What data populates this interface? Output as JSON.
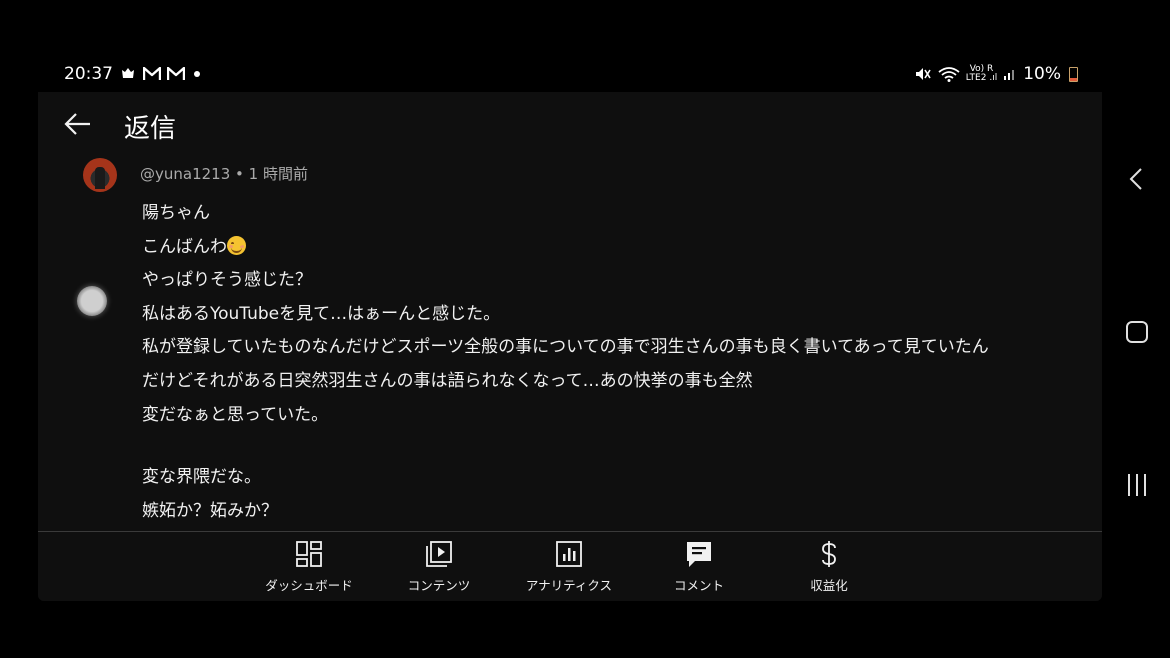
{
  "status_bar": {
    "time": "20:37",
    "notification_icons": [
      "bug-icon",
      "gmail-icon",
      "gmail-icon",
      "dot-icon"
    ],
    "network_label_top": "Vo) R",
    "network_label_bottom": "LTE2 .ıl",
    "battery": "10%"
  },
  "header": {
    "title": "返信"
  },
  "comment": {
    "meta": "@yuna1213 • 1 時間前",
    "lines": [
      "陽ちゃん",
      "こんばんわ",
      "やっぱりそう感じた？",
      "私はあるYouTubeを見て…はぁーんと感じた。",
      "私が登録していたものなんだけどスポーツ全般の事についての事で羽生さんの事も良く書いてあって見ていたん",
      "だけどそれがある日突然羽生さんの事は語られなくなって…あの快挙の事も全然",
      "変だなぁと思っていた。",
      "",
      "変な界隈だな。",
      "嫉妬か？妬みか？"
    ]
  },
  "bottom_nav": {
    "items": [
      {
        "label": "ダッシュボード",
        "icon": "dashboard-icon"
      },
      {
        "label": "コンテンツ",
        "icon": "content-icon"
      },
      {
        "label": "アナリティクス",
        "icon": "analytics-icon"
      },
      {
        "label": "コメント",
        "icon": "comment-icon"
      },
      {
        "label": "収益化",
        "icon": "dollar-icon"
      }
    ],
    "active": "コメント"
  },
  "colors": {
    "background": "#0f0f0f",
    "text": "#f1f1f1",
    "meta_text": "#aaaaaa",
    "divider": "#3a3a3a"
  }
}
